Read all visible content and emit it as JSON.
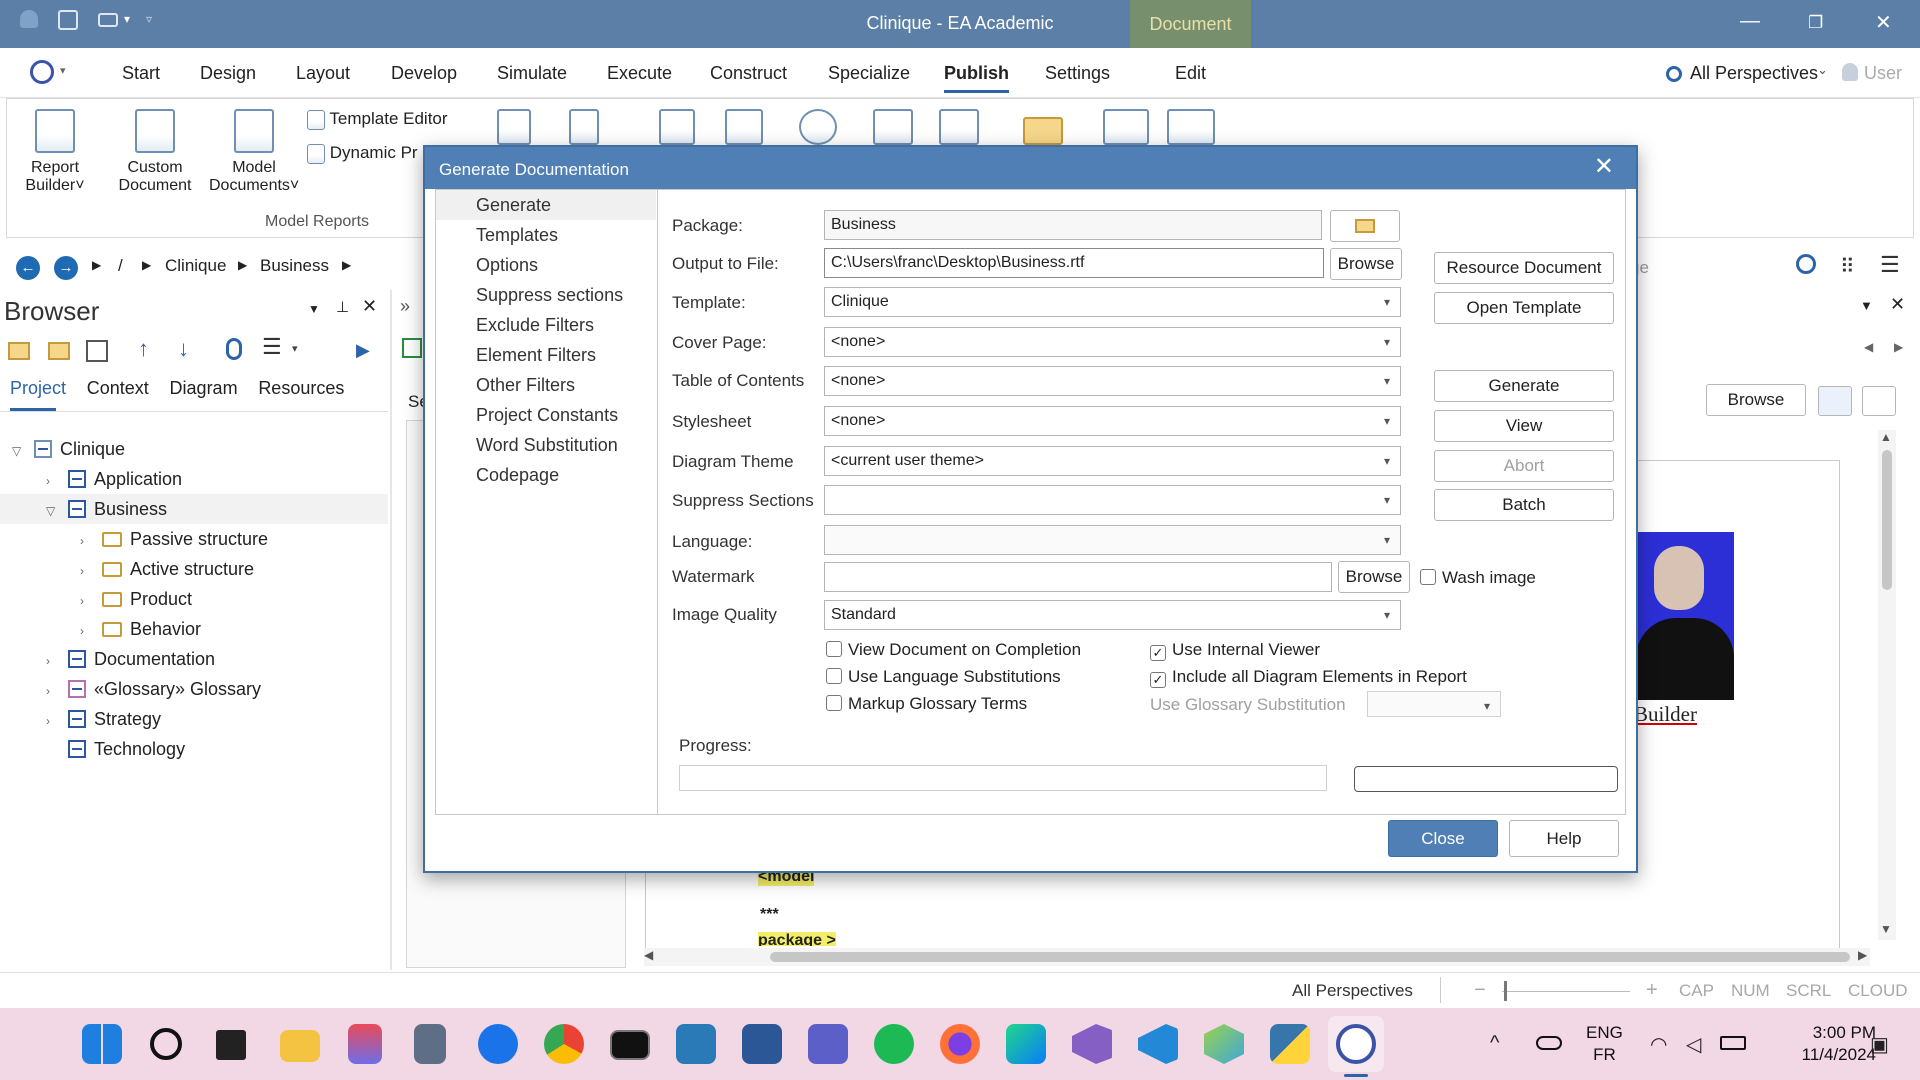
{
  "window": {
    "title": "Clinique - EA Academic",
    "context_tab": "Document"
  },
  "menu": {
    "items": [
      "Start",
      "Design",
      "Layout",
      "Develop",
      "Simulate",
      "Execute",
      "Construct",
      "Specialize",
      "Publish",
      "Settings",
      "Edit"
    ],
    "active": "Publish",
    "perspectives": "All Perspectives",
    "user": "User"
  },
  "ribbon": {
    "report_builder": [
      "Report",
      "Builder"
    ],
    "custom_document": [
      "Custom",
      "Document"
    ],
    "model_documents": [
      "Model",
      "Documents"
    ],
    "template_editor": "Template Editor",
    "dynamic_prefix": "Dynamic Pr",
    "group_label": "Model Reports"
  },
  "breadcrumb": {
    "separator": "/",
    "items": [
      "Clinique",
      "Business"
    ]
  },
  "browser": {
    "title": "Browser",
    "tabs": [
      "Project",
      "Context",
      "Diagram",
      "Resources"
    ],
    "tree": [
      {
        "label": "Clinique",
        "level": 0,
        "type": "model",
        "expanded": true
      },
      {
        "label": "Application",
        "level": 1,
        "type": "package"
      },
      {
        "label": "Business",
        "level": 1,
        "type": "package",
        "expanded": true,
        "selected": true
      },
      {
        "label": "Passive structure",
        "level": 2,
        "type": "folder"
      },
      {
        "label": "Active structure",
        "level": 2,
        "type": "folder"
      },
      {
        "label": "Product",
        "level": 2,
        "type": "folder"
      },
      {
        "label": "Behavior",
        "level": 2,
        "type": "folder"
      },
      {
        "label": "Documentation",
        "level": 1,
        "type": "package"
      },
      {
        "label": "«Glossary» Glossary",
        "level": 1,
        "type": "package"
      },
      {
        "label": "Strategy",
        "level": 1,
        "type": "package"
      },
      {
        "label": "Technology",
        "level": 1,
        "type": "package"
      }
    ]
  },
  "background": {
    "partial_tab": "Se",
    "search_fragment": "ge",
    "browse": "Browse",
    "builder_caption": "Builder",
    "doc_lines": [
      "<model",
      "***",
      "package >"
    ]
  },
  "dialog": {
    "title": "Generate Documentation",
    "nav": [
      "Generate",
      "Templates",
      "Options",
      "Suppress sections",
      "Exclude Filters",
      "Element Filters",
      "Other Filters",
      "Project Constants",
      "Word Substitution",
      "Codepage"
    ],
    "nav_selected": "Generate",
    "fields": {
      "package": {
        "label": "Package:",
        "value": "Business"
      },
      "output": {
        "label": "Output to File:",
        "value": "C:\\Users\\franc\\Desktop\\Business.rtf"
      },
      "template": {
        "label": "Template:",
        "value": "Clinique"
      },
      "cover": {
        "label": "Cover Page:",
        "value": "<none>"
      },
      "toc": {
        "label": "Table of Contents",
        "value": "<none>"
      },
      "stylesheet": {
        "label": "Stylesheet",
        "value": "<none>"
      },
      "theme": {
        "label": "Diagram Theme",
        "value": "<current user theme>"
      },
      "suppress": {
        "label": "Suppress Sections",
        "value": ""
      },
      "language": {
        "label": "Language:",
        "value": ""
      },
      "watermark": {
        "label": "Watermark",
        "value": ""
      },
      "quality": {
        "label": "Image Quality",
        "value": "Standard"
      }
    },
    "browse_label": "Browse",
    "wash_image": {
      "label": "Wash image",
      "checked": false
    },
    "buttons": {
      "resource_document": "Resource Document",
      "open_template": "Open Template",
      "generate": "Generate",
      "view": "View",
      "abort": "Abort",
      "batch": "Batch",
      "close": "Close",
      "help": "Help"
    },
    "checks": [
      {
        "label": "View Document on Completion",
        "checked": false
      },
      {
        "label": "Use Language Substitutions",
        "checked": false
      },
      {
        "label": "Markup Glossary Terms",
        "checked": false
      },
      {
        "label": "Use Internal Viewer",
        "checked": true
      },
      {
        "label": "Include all Diagram Elements in Report",
        "checked": true
      }
    ],
    "glossary_substitution": "Use Glossary Substitution",
    "progress_label": "Progress:",
    "progress": 0
  },
  "status": {
    "perspectives": "All Perspectives",
    "zoom_minus": "−",
    "zoom_plus": "+",
    "cap": "CAP",
    "num": "NUM",
    "scrl": "SCRL",
    "cloud": "CLOUD"
  },
  "taskbar": {
    "apps": [
      "start-icon",
      "search-icon",
      "task-view-icon",
      "file-explorer-icon",
      "snipping-tool-icon",
      "calculator-icon",
      "edge-icon",
      "chrome-icon",
      "terminal-icon",
      "powershell-icon",
      "word-icon",
      "teams-icon",
      "spotify-icon",
      "firefox-icon",
      "webstorm-icon",
      "visual-studio-icon",
      "vscode-icon",
      "enterprise-architect-cube-icon",
      "python-icon",
      "sparx-ea-icon"
    ],
    "lang": "ENG",
    "layout": "FR",
    "time": "3:00 PM",
    "date": "11/4/2024"
  },
  "colors": {
    "titlebar": "#5b7fa6",
    "dialog_title": "#4f7fb4",
    "accent": "#2d63a8",
    "taskbar": "#f2d7e4"
  }
}
